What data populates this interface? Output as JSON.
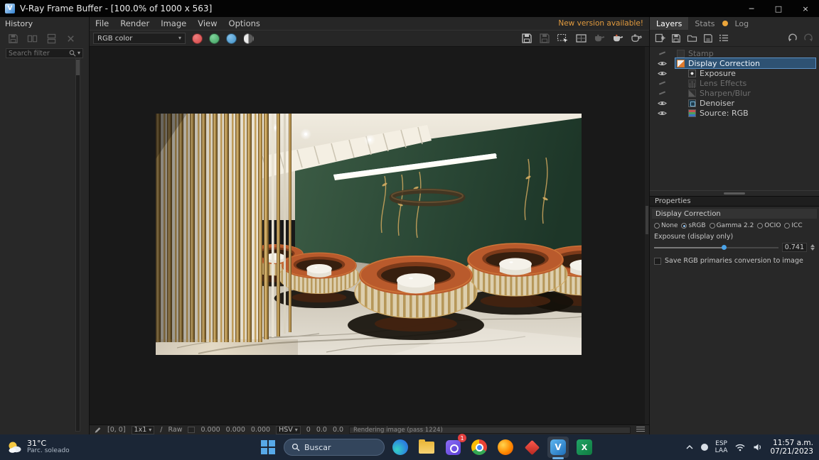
{
  "glyphs": {
    "caret_down": "▾",
    "slash": "/",
    "minimize": "─",
    "maximize": "□",
    "close": "×",
    "logo_letter": "V"
  },
  "titlebar": {
    "title": "V-Ray Frame Buffer - [100.0% of 1000 x 563]"
  },
  "menubar": {
    "items": [
      "File",
      "Render",
      "Image",
      "View",
      "Options"
    ],
    "new_version": "New version available!"
  },
  "history": {
    "title": "History",
    "search_placeholder": "Search filter",
    "tool_icons": [
      "save-history",
      "compare-horizontal",
      "compare-vertical",
      "remove-history"
    ]
  },
  "toolbar": {
    "channel_mode": "RGB color",
    "channel_icons": [
      "red-channel",
      "green-channel",
      "blue-channel",
      "alpha-channel"
    ],
    "action_icons": [
      "save-image",
      "duplicate-buffer",
      "region-render",
      "proportion-guides",
      "stop-render",
      "interactive-render",
      "render-last"
    ]
  },
  "right_panel": {
    "tabs": [
      "Layers",
      "Stats",
      "Log"
    ],
    "active_tab": "Layers",
    "tool_icons": [
      "create-layer",
      "save-layers",
      "load-layers",
      "save-preset",
      "layer-options",
      "undo",
      "redo"
    ],
    "layers": [
      {
        "name": "Stamp",
        "visible": false,
        "enabled": false,
        "selected": false
      },
      {
        "name": "Display Correction",
        "visible": true,
        "enabled": true,
        "selected": true
      },
      {
        "name": "Exposure",
        "visible": true,
        "enabled": true,
        "selected": false
      },
      {
        "name": "Lens Effects",
        "visible": false,
        "enabled": false,
        "selected": false
      },
      {
        "name": "Sharpen/Blur",
        "visible": false,
        "enabled": false,
        "selected": false
      },
      {
        "name": "Denoiser",
        "visible": true,
        "enabled": true,
        "selected": false
      },
      {
        "name": "Source: RGB",
        "visible": true,
        "enabled": true,
        "selected": false
      }
    ],
    "properties": {
      "title": "Properties",
      "section": "Display Correction",
      "radio_options": [
        "None",
        "sRGB",
        "Gamma 2.2",
        "OCIO",
        "ICC"
      ],
      "selected_radio": "sRGB",
      "exposure_label": "Exposure (display only)",
      "exposure_value": "0.741",
      "checkbox_label": "Save RGB primaries conversion to image",
      "checkbox_checked": false
    }
  },
  "statusbar": {
    "coords": "[0, 0]",
    "zoom": "1x1",
    "mode": "Raw",
    "r": "0.000",
    "g": "0.000",
    "b": "0.000",
    "hsv_label": "HSV",
    "h": "0",
    "s": "0.0",
    "v": "0.0",
    "progress": "Rendering image (pass 1224)"
  },
  "taskbar": {
    "weather_temp": "31°C",
    "weather_desc": "Parc. soleado",
    "search_placeholder": "Buscar",
    "app_icons": [
      "edge",
      "file-explorer",
      "purple-app",
      "chrome",
      "firefox",
      "red-diamond-app",
      "vray",
      "excel"
    ],
    "active_app": "vray",
    "notification_badge": "1",
    "vray_glyph": "V",
    "excel_glyph": "X",
    "tray": {
      "lang_top": "ESP",
      "lang_bottom": "LAA",
      "time": "11:57 a.m.",
      "date": "07/21/2023"
    }
  }
}
